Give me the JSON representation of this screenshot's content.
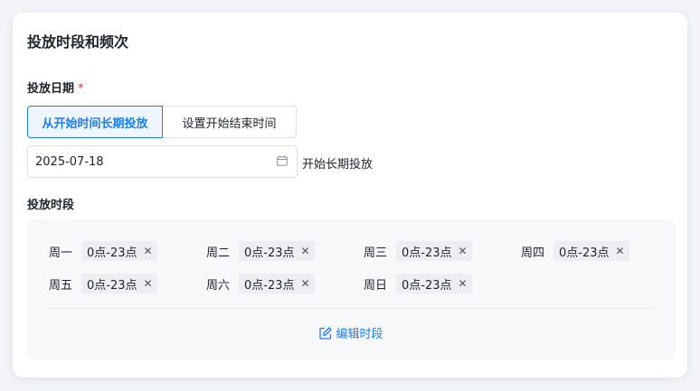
{
  "section": {
    "title": "投放时段和频次"
  },
  "schedule_date": {
    "label": "投放日期",
    "required_mark": "*",
    "options": [
      "从开始时间长期投放",
      "设置开始结束时间"
    ],
    "selected_index": 0,
    "start_date": "2025-07-18",
    "suffix": "开始长期投放"
  },
  "time_slots": {
    "label": "投放时段",
    "days": [
      {
        "day": "周一",
        "range": "0点-23点"
      },
      {
        "day": "周二",
        "range": "0点-23点"
      },
      {
        "day": "周三",
        "range": "0点-23点"
      },
      {
        "day": "周四",
        "range": "0点-23点"
      },
      {
        "day": "周五",
        "range": "0点-23点"
      },
      {
        "day": "周六",
        "range": "0点-23点"
      },
      {
        "day": "周日",
        "range": "0点-23点"
      }
    ],
    "remove_glyph": "✕",
    "edit_label": "编辑时段"
  },
  "colors": {
    "accent": "#1f7fe8",
    "required": "#f5222d",
    "panel_bg": "#f7f8fa"
  }
}
